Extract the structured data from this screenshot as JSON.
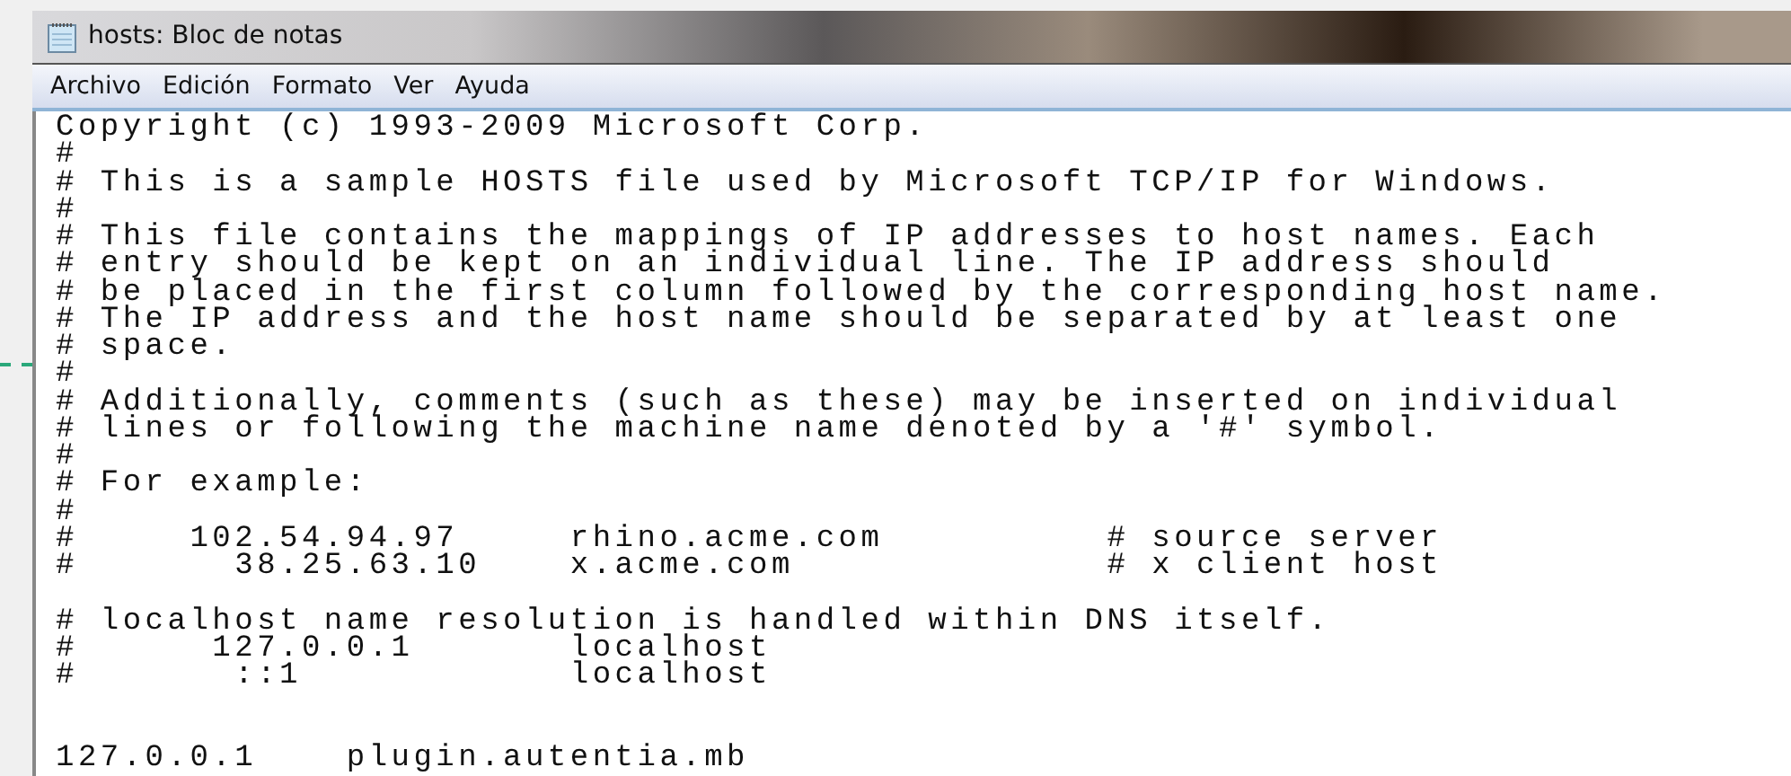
{
  "window": {
    "title": "hosts: Bloc de notas"
  },
  "menu": [
    "Archivo",
    "Edición",
    "Formato",
    "Ver",
    "Ayuda"
  ],
  "editor": {
    "content": "Copyright (c) 1993-2009 Microsoft Corp.\n#\n# This is a sample HOSTS file used by Microsoft TCP/IP for Windows.\n#\n# This file contains the mappings of IP addresses to host names. Each\n# entry should be kept on an individual line. The IP address should\n# be placed in the first column followed by the corresponding host name.\n# The IP address and the host name should be separated by at least one\n# space.\n#\n# Additionally, comments (such as these) may be inserted on individual\n# lines or following the machine name denoted by a '#' symbol.\n#\n# For example:\n#\n#     102.54.94.97     rhino.acme.com          # source server\n#       38.25.63.10    x.acme.com              # x client host\n\n# localhost name resolution is handled within DNS itself.\n#      127.0.0.1       localhost\n#       ::1            localhost\n\n\n127.0.0.1    plugin.autentia.mb"
  }
}
